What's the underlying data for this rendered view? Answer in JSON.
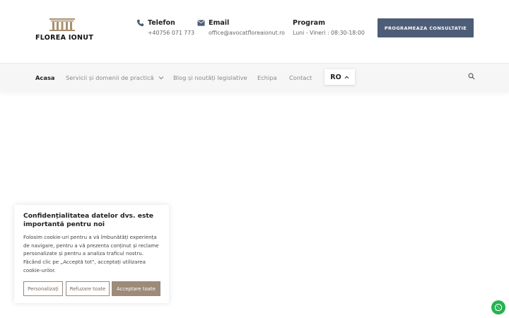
{
  "brand": {
    "logo_text": "FLOREA IONUT"
  },
  "contact": {
    "phone": {
      "icon": "phone-icon",
      "title": "Telefon",
      "value": "+40756 071 773"
    },
    "email": {
      "icon": "envelope-icon",
      "title": "Email",
      "value": "office@avocatfloreaionut.ro"
    },
    "program": {
      "title": "Program",
      "value": "Luni - Vineri : 08:30-18:00"
    }
  },
  "cta": {
    "label": "PROGRAMEAZA CONSULTATIE"
  },
  "nav": {
    "items": [
      {
        "label": "Acasa",
        "active": true
      },
      {
        "label": "Servicii și domenii de practică",
        "has_dropdown": true
      },
      {
        "label": "Blog și noutăți legislative"
      },
      {
        "label": "Echipa"
      },
      {
        "label": "Contact"
      }
    ],
    "language": "RO"
  },
  "cookie": {
    "title": "Confidențialitatea datelor dvs. este importantă pentru noi",
    "body": "Folosim cookie-uri pentru a vă îmbunătăți experiența de navigare, pentru a vă prezenta conținut și reclame personalizate și pentru a analiza traficul nostru. Făcând clic pe „Acceptă tot”, acceptați utilizarea cookie-urilor.",
    "buttons": {
      "customize": "Personalizați",
      "reject": "Refuzare toate",
      "accept": "Acceptare toate"
    }
  },
  "colors": {
    "primary_button": "#4e5d77",
    "cookie_accent": "#9d8a79",
    "whatsapp": "#25b350"
  }
}
